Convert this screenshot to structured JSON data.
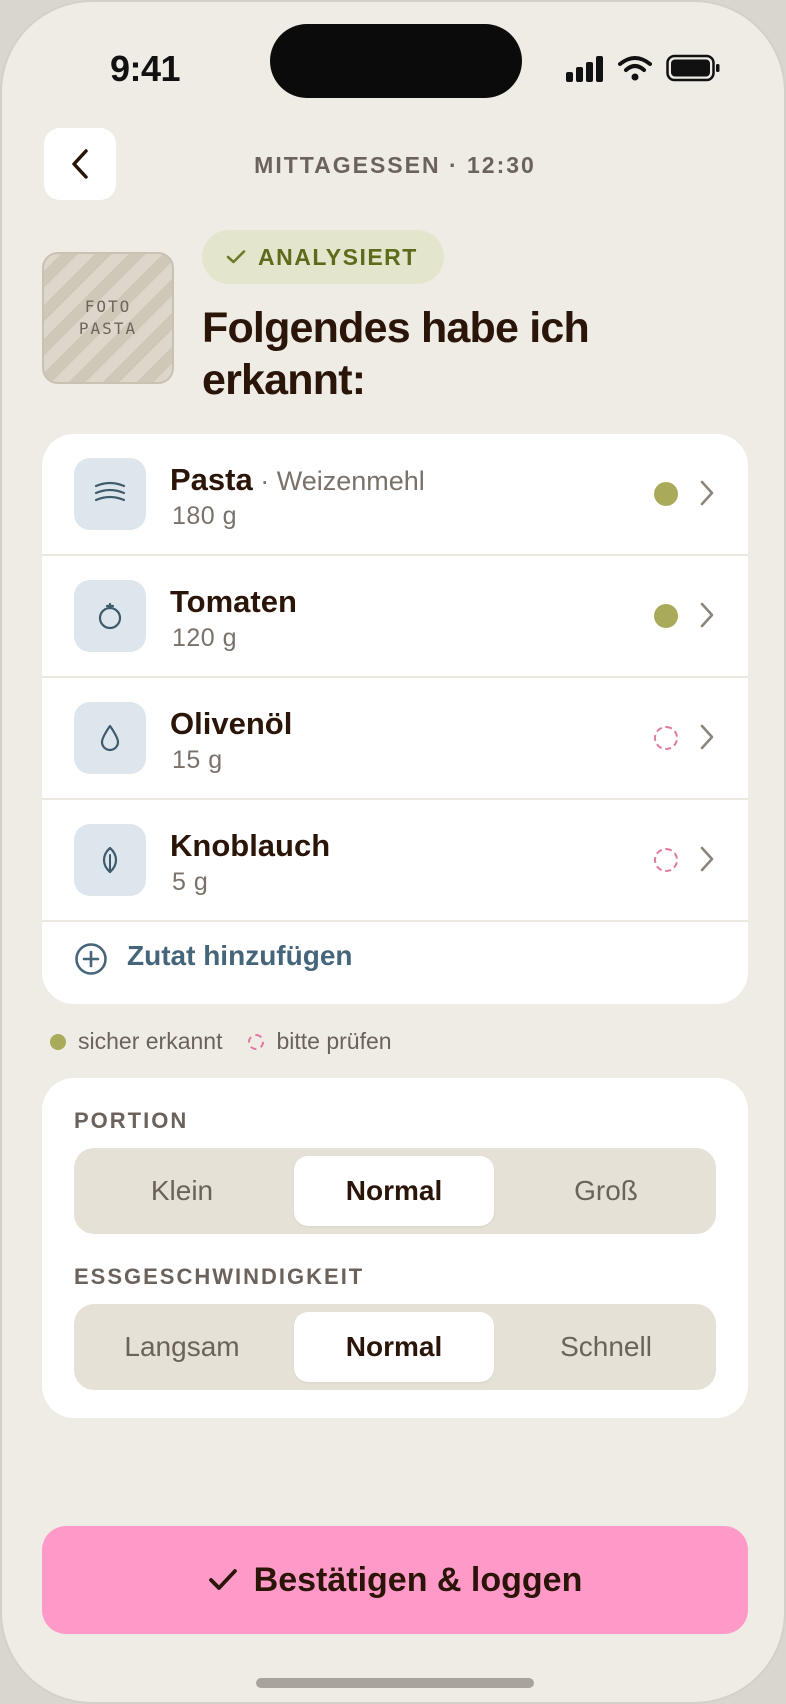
{
  "status_bar": {
    "time": "9:41"
  },
  "header": {
    "title": "MITTAGESSEN · 12:30"
  },
  "hero": {
    "photo_placeholder_line1": "FOTO",
    "photo_placeholder_line2": "PASTA",
    "badge": "ANALYSIERT",
    "title": "Folgendes habe ich erkannt:"
  },
  "ingredients": [
    {
      "name": "Pasta",
      "sub": " · Weizenmehl",
      "amount": "180 g",
      "icon": "pasta-icon",
      "status": "sicher"
    },
    {
      "name": "Tomaten",
      "sub": "",
      "amount": "120 g",
      "icon": "tomato-icon",
      "status": "sicher"
    },
    {
      "name": "Olivenöl",
      "sub": "",
      "amount": "15 g",
      "icon": "oil-drop-icon",
      "status": "prüfen"
    },
    {
      "name": "Knoblauch",
      "sub": "",
      "amount": "5 g",
      "icon": "garlic-leaf-icon",
      "status": "prüfen"
    }
  ],
  "add_ingredient": {
    "label": "Zutat hinzufügen"
  },
  "legend": {
    "sure": "sicher erkannt",
    "check": "bitte prüfen"
  },
  "portion": {
    "label": "PORTION",
    "options": [
      "Klein",
      "Normal",
      "Groß"
    ],
    "selected": "Normal"
  },
  "speed": {
    "label": "ESSGESCHWINDIGKEIT",
    "options": [
      "Langsam",
      "Normal",
      "Schnell"
    ],
    "selected": "Normal"
  },
  "confirm": {
    "label": "Bestätigen & loggen"
  },
  "colors": {
    "accent_pink": "#ff9ac8",
    "sure_green": "#a9aa5a",
    "check_pink": "#e0779f",
    "link_blue": "#44657a"
  }
}
